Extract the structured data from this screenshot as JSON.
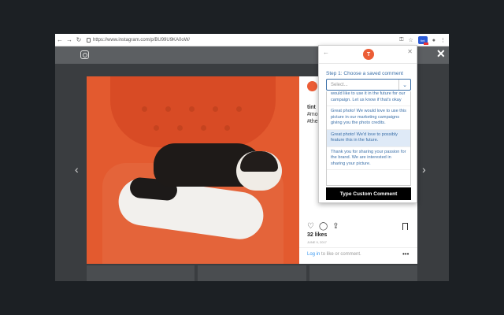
{
  "browser": {
    "url": "https://www.instagram.com/p/BU99U9KA0oW/",
    "ext_badge": "tint"
  },
  "post": {
    "caption_lines": [
      "tint",
      "#mo",
      "#the"
    ],
    "likes": "32 likes",
    "date": "JUNE 9, 2017",
    "login_link": "Log in",
    "login_rest": " to like or comment.",
    "more": "•••"
  },
  "panel": {
    "logo_letter": "T",
    "step_label": "Step 1: Choose a saved comment",
    "select_placeholder": "Select...",
    "options": [
      "would like to use it in the future for our campaign. Let us know if that's okay",
      "Great photo! We would love to use this picture in our marketing campaigns giving you the photo credits.",
      "Great photo! We'd love to possibly feature this in the future.",
      "Thank you for sharing your passion for the brand. We are interested in sharing your picture."
    ],
    "custom_button": "Type Custom Comment"
  },
  "colors": {
    "accent": "#ec5d36",
    "link": "#3a6fa8"
  }
}
